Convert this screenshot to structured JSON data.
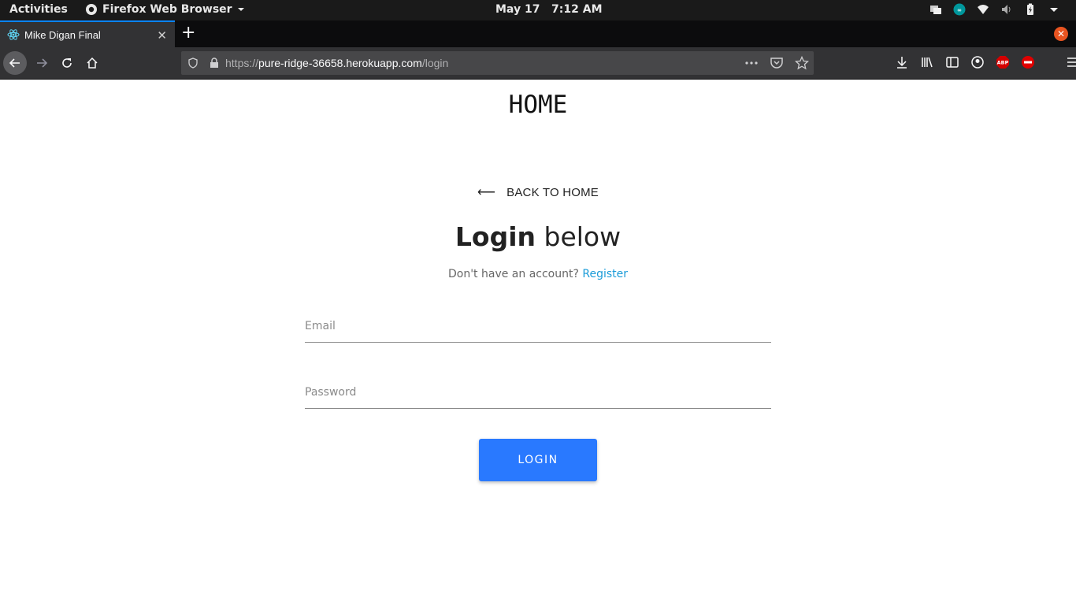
{
  "system_bar": {
    "activities": "Activities",
    "app_name": "Firefox Web Browser",
    "clock": "May 17   7:12 AM"
  },
  "browser": {
    "tab_title": "Mike Digan Final",
    "url_prefix": "https://",
    "url_host": "pure-ridge-36658.herokuapp.com",
    "url_path": "/login",
    "icons": [
      "back-icon",
      "forward-icon",
      "reload-icon",
      "home-icon",
      "shield-icon",
      "lock-icon",
      "more-icon",
      "pocket-icon",
      "bookmark-star-icon",
      "download-icon",
      "library-icon",
      "sidebar-icon",
      "account-icon",
      "adblock-icon",
      "blocker-icon",
      "menu-icon"
    ],
    "adblock_label": "ABP"
  },
  "page": {
    "site_title": "HOME",
    "back_link": "BACK TO HOME",
    "heading_bold": "Login",
    "heading_rest": " below",
    "subtext": "Don't have an account?",
    "register_link": "Register",
    "email_placeholder": "Email",
    "password_placeholder": "Password",
    "login_button": "LOGIN"
  },
  "colors": {
    "button": "#2979ff",
    "link": "#1a9bd8",
    "accent_tab": "#0a84ff"
  }
}
